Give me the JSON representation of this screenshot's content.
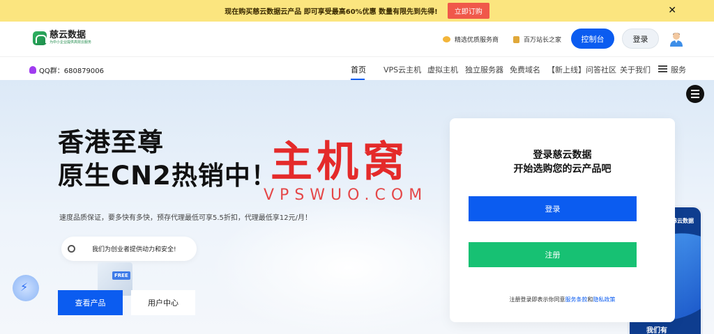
{
  "promo": {
    "text": "现在购买慈云数据云产品 即可享受最高60%优惠 数量有限先到先得!",
    "button": "立即订购",
    "close": "✕"
  },
  "header": {
    "logo_name": "慈云数据",
    "logo_sub": "为中小企业提供高效云服务",
    "link1": "精选优质服务商",
    "link2": "百万站长之家",
    "console": "控制台",
    "login": "登录"
  },
  "nav": {
    "qq": "QQ群：680879006",
    "items": [
      "首页",
      "VPS云主机",
      "虚拟主机",
      "独立服务器",
      "免费域名",
      "【新上线】问答社区",
      "关于我们",
      "服务"
    ]
  },
  "hero": {
    "title_line1": "香港至尊",
    "title_line2": "原生CN2热销中！",
    "desc": "速度品质保证，要多快有多快，预存代理最低可享5.5折扣，代理最低享12元/月！",
    "slogan": "我们为创业者提供动力和安全!",
    "btn_view": "查看产品",
    "btn_user": "用户中心",
    "free_badge": "FREE"
  },
  "watermark": {
    "main": "主机窝",
    "sub": "VPSWUO.COM"
  },
  "card": {
    "title1": "登录慈云数据",
    "title2": "开始选购您的云产品吧",
    "login": "登录",
    "register": "注册",
    "note_prefix": "注册登录即表示你同意",
    "note_link1": "服务条款",
    "note_and": "和",
    "note_link2": "隐私政策"
  },
  "phone": {
    "brand": "慈云数据",
    "text": "我们有"
  },
  "colors": {
    "accent": "#0b5cf0",
    "register": "#17c173",
    "promo_bg": "#fbe57f",
    "promo_btn": "#f0584a",
    "watermark": "#e42a2a"
  }
}
